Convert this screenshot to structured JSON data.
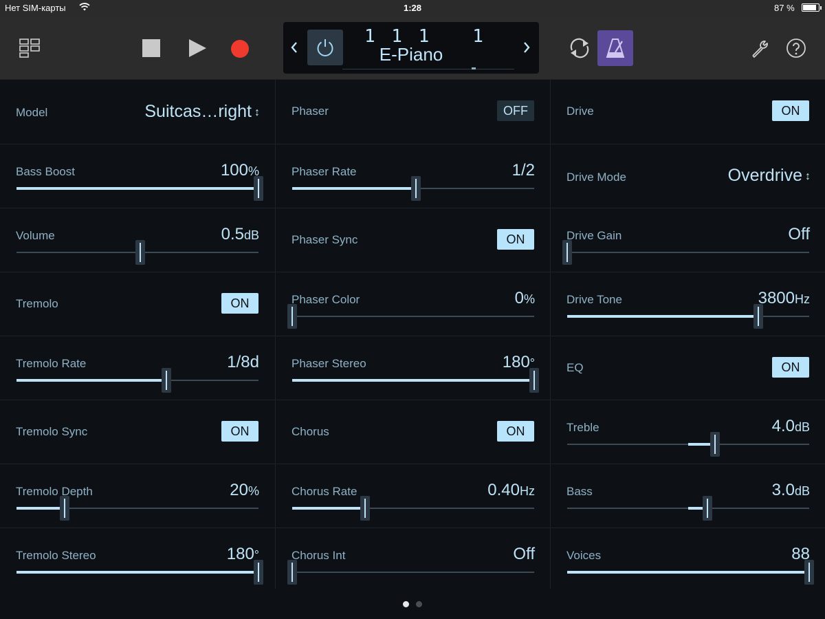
{
  "status_bar": {
    "carrier": "Нет SIM-карты",
    "time": "1:28",
    "battery_percent": "87 %",
    "battery_level": 0.87
  },
  "control_bar": {
    "icons": {
      "browser": "browser-grid-icon",
      "stop": "stop-icon",
      "play": "play-icon",
      "record": "record-icon",
      "prev": "chevron-left-icon",
      "next": "chevron-right-icon",
      "power": "power-icon",
      "cycle": "cycle-icon",
      "metronome": "metronome-icon",
      "settings": "wrench-icon",
      "help": "help-icon"
    },
    "lcd": {
      "position": "1 1 1   1",
      "instrument": "E-Piano",
      "scrub_position": 0.75
    },
    "colors": {
      "record": "#f03a2e",
      "metronome_bg": "#5b4a9a",
      "accent": "#bfe3f6"
    }
  },
  "columns": [
    [
      {
        "type": "select",
        "label": "Model",
        "value": "Suitcas…right"
      },
      {
        "type": "slider",
        "label": "Bass Boost",
        "value": "100",
        "unit": "%",
        "level": 1.0
      },
      {
        "type": "slider",
        "label": "Volume",
        "value": "0.5",
        "unit": "dB",
        "level": 0.51,
        "bipolar": true
      },
      {
        "type": "toggle",
        "label": "Tremolo",
        "state": "ON"
      },
      {
        "type": "slider",
        "label": "Tremolo Rate",
        "value": "1/8d",
        "unit": "",
        "level": 0.62
      },
      {
        "type": "toggle",
        "label": "Tremolo Sync",
        "state": "ON"
      },
      {
        "type": "slider",
        "label": "Tremolo Depth",
        "value": "20",
        "unit": "%",
        "level": 0.2
      },
      {
        "type": "slider",
        "label": "Tremolo Stereo",
        "value": "180",
        "unit": "°",
        "level": 1.0
      }
    ],
    [
      {
        "type": "toggle",
        "label": "Phaser",
        "state": "OFF"
      },
      {
        "type": "slider",
        "label": "Phaser Rate",
        "value": "1/2",
        "unit": "",
        "level": 0.51
      },
      {
        "type": "toggle",
        "label": "Phaser Sync",
        "state": "ON"
      },
      {
        "type": "slider",
        "label": "Phaser Color",
        "value": "0",
        "unit": "%",
        "level": 0.0
      },
      {
        "type": "slider",
        "label": "Phaser Stereo",
        "value": "180",
        "unit": "°",
        "level": 1.0
      },
      {
        "type": "toggle",
        "label": "Chorus",
        "state": "ON"
      },
      {
        "type": "slider",
        "label": "Chorus Rate",
        "value": "0.40",
        "unit": "Hz",
        "level": 0.3
      },
      {
        "type": "slider",
        "label": "Chorus Int",
        "value": "Off",
        "unit": "",
        "level": 0.0
      }
    ],
    [
      {
        "type": "toggle",
        "label": "Drive",
        "state": "ON"
      },
      {
        "type": "select",
        "label": "Drive Mode",
        "value": "Overdrive"
      },
      {
        "type": "slider",
        "label": "Drive Gain",
        "value": "Off",
        "unit": "",
        "level": 0.0
      },
      {
        "type": "slider",
        "label": "Drive Tone",
        "value": "3800",
        "unit": "Hz",
        "level": 0.79
      },
      {
        "type": "toggle",
        "label": "EQ",
        "state": "ON"
      },
      {
        "type": "slider",
        "label": "Treble",
        "value": "4.0",
        "unit": "dB",
        "level": 0.61,
        "bipolar": true
      },
      {
        "type": "slider",
        "label": "Bass",
        "value": "3.0",
        "unit": "dB",
        "level": 0.58,
        "bipolar": true
      },
      {
        "type": "slider",
        "label": "Voices",
        "value": "88",
        "unit": "",
        "level": 1.0
      }
    ]
  ],
  "page_indicator": {
    "current": 1,
    "total": 2
  }
}
